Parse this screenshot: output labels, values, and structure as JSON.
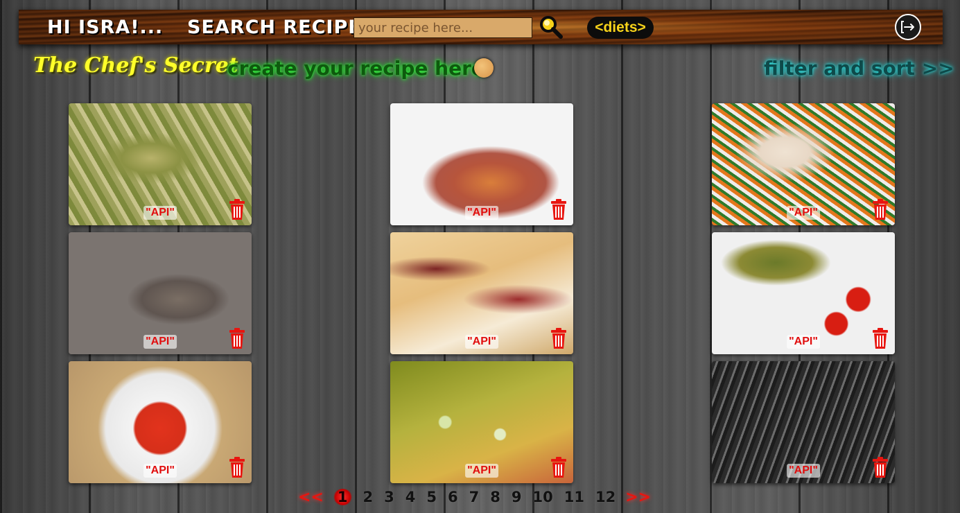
{
  "header": {
    "greeting": "HI ISRA!...",
    "search_label": "SEARCH RECIPE:",
    "search_placeholder": "your recipe here...",
    "search_value": "",
    "diets_label": "<diets>",
    "logout_icon": "logout-icon"
  },
  "nav": {
    "brand": "The Chef's Secret",
    "create_link": "create your recipe here",
    "filter_link": "filter and sort >>"
  },
  "cards": [
    {
      "source": "\"API\"",
      "icon": "trash-icon"
    },
    {
      "source": "\"API\"",
      "icon": "trash-icon"
    },
    {
      "source": "\"API\"",
      "icon": "trash-icon"
    },
    {
      "source": "\"API\"",
      "icon": "trash-icon"
    },
    {
      "source": "\"API\"",
      "icon": "trash-icon"
    },
    {
      "source": "\"API\"",
      "icon": "trash-icon"
    },
    {
      "source": "\"API\"",
      "icon": "trash-icon"
    },
    {
      "source": "\"API\"",
      "icon": "trash-icon"
    },
    {
      "source": "\"API\"",
      "icon": "trash-icon"
    }
  ],
  "pagination": {
    "prev": "<<",
    "next": ">>",
    "pages": [
      "1",
      "2",
      "3",
      "4",
      "5",
      "6",
      "7",
      "8",
      "9",
      "10",
      "11",
      "12"
    ],
    "current": "1"
  },
  "colors": {
    "brand": "#ffff2a",
    "create_link_glow": "#2dff3a",
    "filter_link_glow": "#29e2e2",
    "diets_text": "#f6d21a",
    "api_tag": "#e10e0e",
    "trash": "#e8150f",
    "pager_arrows": "#e8150f"
  }
}
